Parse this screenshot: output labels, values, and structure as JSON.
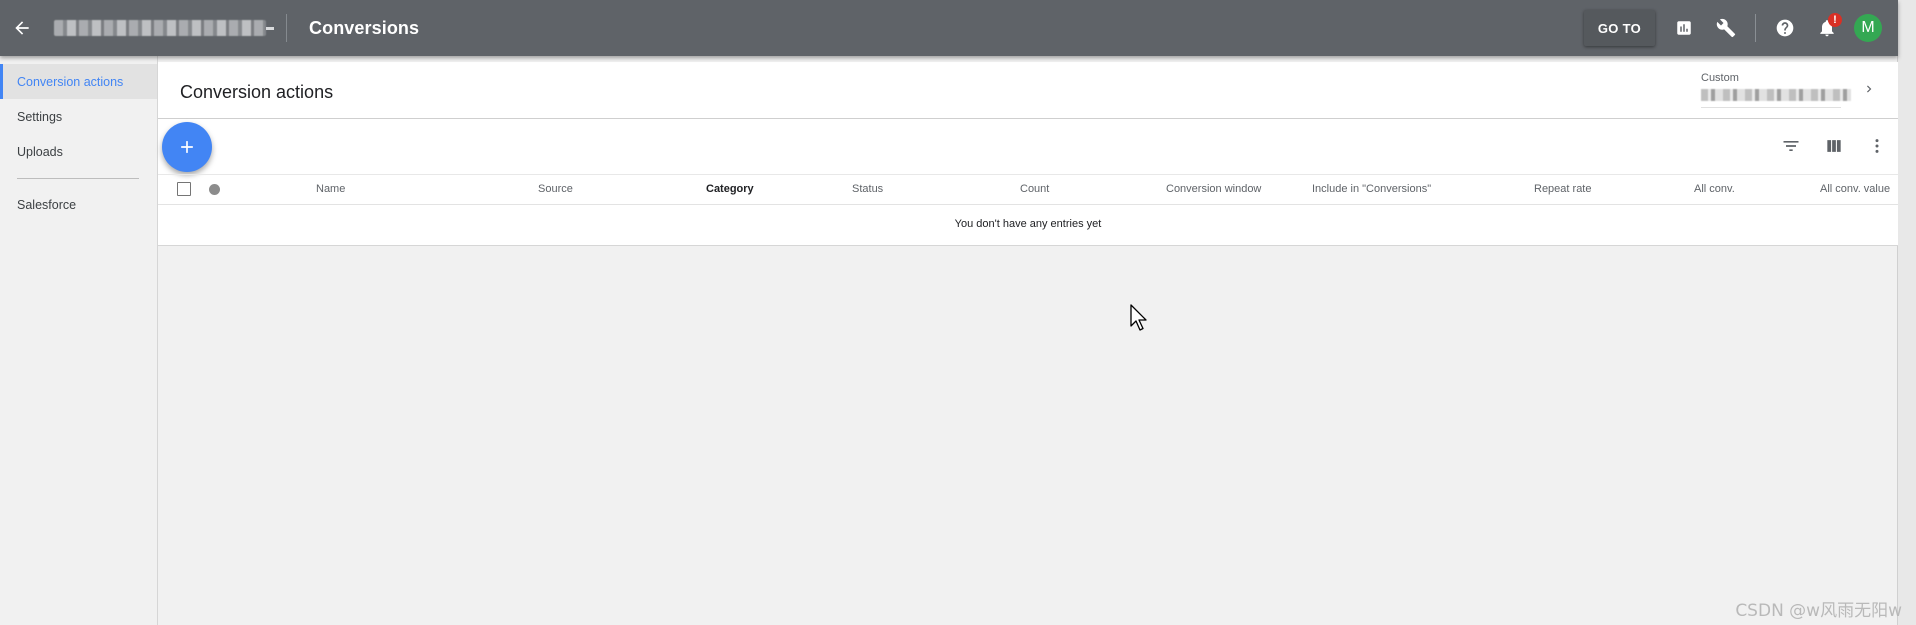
{
  "topbar": {
    "account_name": "",
    "page_title": "Conversions",
    "goto_label": "GO TO",
    "notification_badge": "!",
    "avatar_initial": "M",
    "colors": {
      "bar": "#5f6368",
      "avatar": "#34a853",
      "badge": "#d93025"
    },
    "icons": [
      "back-arrow-icon",
      "reports-icon",
      "tools-icon",
      "help-icon",
      "notifications-icon"
    ]
  },
  "leftnav": {
    "items": [
      {
        "label": "Conversion actions",
        "active": true
      },
      {
        "label": "Settings",
        "active": false
      },
      {
        "label": "Uploads",
        "active": false
      },
      {
        "label": "Salesforce",
        "active": false
      }
    ],
    "accent": "#4285f4"
  },
  "header": {
    "title": "Conversion actions",
    "date_range_label": "Custom",
    "date_range_value": ""
  },
  "toolbar": {
    "add_icon": "plus-icon",
    "icons": [
      "filter-icon",
      "columns-icon",
      "more-vert-icon"
    ]
  },
  "table": {
    "columns": [
      {
        "label": "Name"
      },
      {
        "label": "Source"
      },
      {
        "label": "Category",
        "sorted": true
      },
      {
        "label": "Status"
      },
      {
        "label": "Count"
      },
      {
        "label": "Conversion window"
      },
      {
        "label": "Include in \"Conversions\""
      },
      {
        "label": "Repeat rate"
      },
      {
        "label": "All conv."
      },
      {
        "label": "All conv. value"
      }
    ],
    "empty_message": "You don't have any entries yet"
  },
  "watermark": "CSDN @w风雨无阳w"
}
